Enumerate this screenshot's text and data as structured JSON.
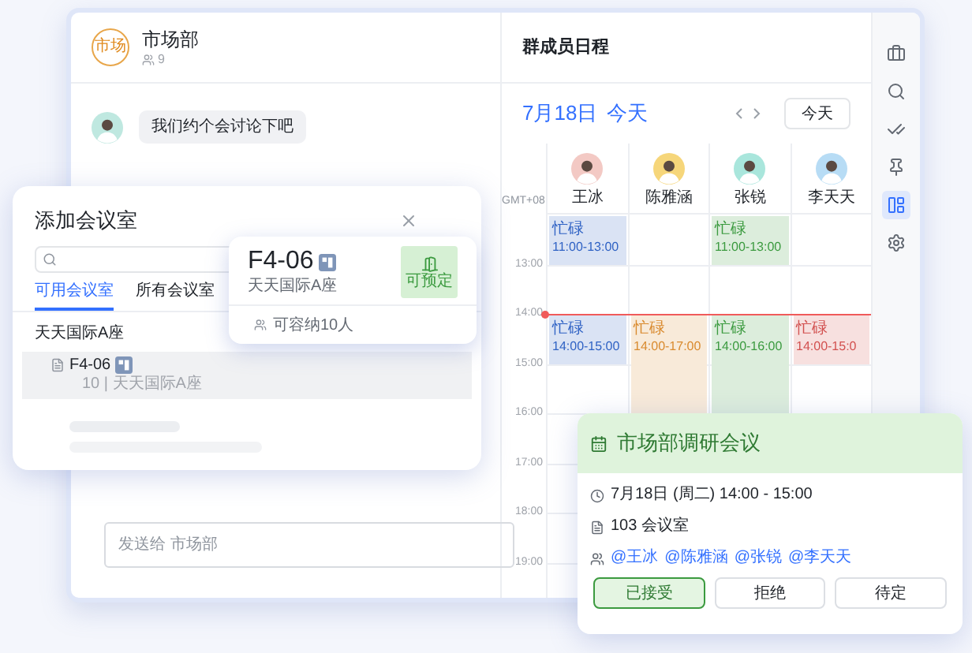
{
  "chat": {
    "group_name": "市场部",
    "group_avatar": "市场",
    "member_count": "9",
    "messages": [
      {
        "text": "我们约个会讨论下吧"
      }
    ],
    "composer": {
      "placeholder": "发送给 市场部"
    }
  },
  "calendar": {
    "title": "群成员日程",
    "date": "7月18日",
    "today_label": "今天",
    "today_button": "今天",
    "timezone": "GMT+08",
    "hours": [
      {
        "label": "13:00",
        "now": false
      },
      {
        "label": "14:00",
        "now": true
      },
      {
        "label": "15:00",
        "now": false
      },
      {
        "label": "16:00",
        "now": false
      },
      {
        "label": "17:00",
        "now": false
      },
      {
        "label": "18:00",
        "now": false
      },
      {
        "label": "19:00",
        "now": false
      }
    ],
    "members": [
      {
        "name": "王冰",
        "color": "#f3c9c4",
        "events": [
          {
            "label": "忙碌",
            "time": "11:00-13:00",
            "color": "#2f62c4"
          },
          {
            "label": "忙碌",
            "time": "14:00-15:00",
            "color": "#2f62c4"
          }
        ]
      },
      {
        "name": "陈雅涵",
        "color": "#f6d67a",
        "events": [
          {
            "label": "忙碌",
            "time": "14:00-17:00",
            "color": "#d98a2e"
          }
        ]
      },
      {
        "name": "张锐",
        "color": "#a9e6dc",
        "events": [
          {
            "label": "忙碌",
            "time": "11:00-13:00",
            "color": "#3b9a3f"
          },
          {
            "label": "忙碌",
            "time": "14:00-16:00",
            "color": "#3b9a3f"
          }
        ]
      },
      {
        "name": "李天天",
        "color": "#b7dcf5",
        "events": [
          {
            "label": "忙碌",
            "time": "14:00-15:0",
            "color": "#d2504f"
          }
        ]
      }
    ]
  },
  "toolbar": [
    {
      "kind": "briefcase",
      "selected": false
    },
    {
      "kind": "search",
      "selected": false
    },
    {
      "kind": "checks",
      "selected": false
    },
    {
      "kind": "pin",
      "selected": false
    },
    {
      "kind": "calendar",
      "selected": true
    },
    {
      "kind": "settings",
      "selected": false
    }
  ],
  "room_dialog": {
    "title": "添加会议室",
    "tabs": [
      {
        "label": "可用会议室",
        "selected": true
      },
      {
        "label": "所有会议室",
        "selected": false
      }
    ],
    "building": "天天国际A座",
    "rooms": [
      {
        "name": "F4-06",
        "meta": "10 | 天天国际A座",
        "selected": true
      }
    ]
  },
  "room_card": {
    "name": "F4-06",
    "building": "天天国际A座",
    "status": "可预定",
    "capacity": "可容纳10人"
  },
  "event_popup": {
    "title": "市场部调研会议",
    "time": "7月18日 (周二) 14:00 - 15:00",
    "room": "103 会议室",
    "attendees": [
      "@王冰",
      "@陈雅涵",
      "@张锐",
      "@李天天"
    ],
    "buttons": [
      {
        "label": "已接受",
        "selected": true
      },
      {
        "label": "拒绝",
        "selected": false
      },
      {
        "label": "待定",
        "selected": false
      }
    ]
  }
}
